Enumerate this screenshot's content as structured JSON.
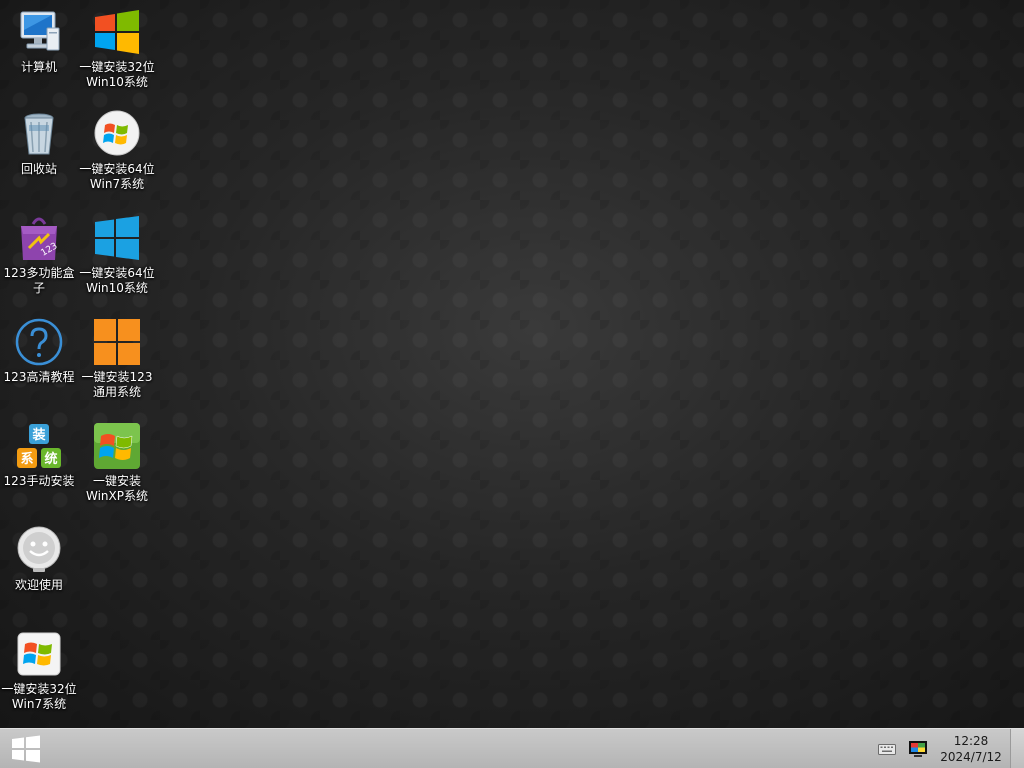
{
  "desktop": {
    "icons": [
      {
        "label": "计算机",
        "icon": "computer-icon"
      },
      {
        "label": "一键安装32位\nWin10系统",
        "icon": "windows10-color-logo-icon"
      },
      {
        "label": "回收站",
        "icon": "recycle-bin-icon"
      },
      {
        "label": "一键安装64位\nWin7系统",
        "icon": "windows7-orb-icon"
      },
      {
        "label": "123多功能盒\n子",
        "icon": "toolbox-bag-icon"
      },
      {
        "label": "一键安装64位\nWin10系统",
        "icon": "windows10-blue-logo-icon"
      },
      {
        "label": "123高清教程",
        "icon": "help-question-icon"
      },
      {
        "label": "一键安装123\n通用系统",
        "icon": "windows-orange-logo-icon"
      },
      {
        "label": "123手动安装",
        "icon": "install-blocks-icon"
      },
      {
        "label": "一键安装\nWinXP系统",
        "icon": "windows-xp-logo-icon"
      },
      {
        "label": "欢迎使用",
        "icon": "smiley-face-icon"
      },
      {
        "label": "一键安装32位\nWin7系统",
        "icon": "windows7-flag-icon"
      }
    ],
    "block_chars": {
      "top": "装",
      "left": "系",
      "right": "统"
    },
    "bag_text": "123"
  },
  "taskbar": {
    "start": "start-windows-icon",
    "tray": {
      "keyboard": "keyboard-icon",
      "display": "display-color-icon"
    },
    "clock": {
      "time": "12:28",
      "date": "2024/7/12"
    }
  },
  "colors": {
    "win_red": "#f25022",
    "win_green": "#7fba00",
    "win_blue": "#00a4ef",
    "win_yellow": "#ffb900",
    "win10_blue": "#1ba1e2",
    "orange": "#f7901e",
    "taskbar": "#c4c4c4"
  }
}
